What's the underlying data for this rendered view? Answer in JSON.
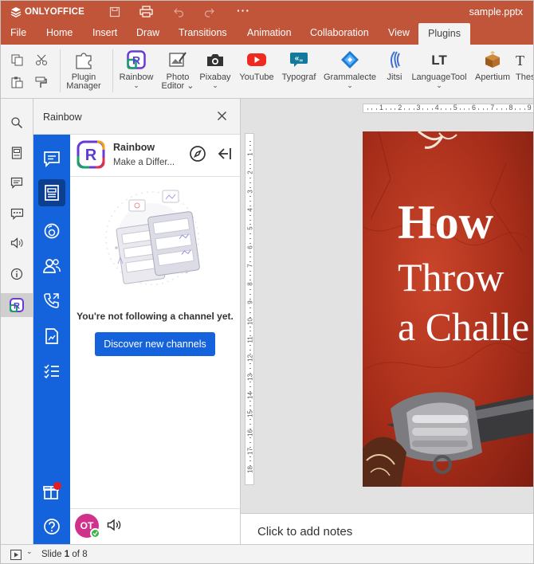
{
  "app": {
    "brand": "ONLYOFFICE",
    "file_name": "sample.pptx"
  },
  "menu": {
    "tabs": [
      "File",
      "Home",
      "Insert",
      "Draw",
      "Transitions",
      "Animation",
      "Collaboration",
      "View",
      "Plugins"
    ],
    "active": "Plugins"
  },
  "toolbar": {
    "plugin_manager": [
      "Plugin",
      "Manager"
    ],
    "plugins": [
      "Rainbow",
      "Photo Editor",
      "Pixabay",
      "YouTube",
      "Typograf",
      "Grammalecte",
      "Jitsi",
      "LanguageTool",
      "Apertium",
      "Thes"
    ],
    "photo_editor_lines": [
      "Photo",
      "Editor"
    ]
  },
  "panel": {
    "title": "Rainbow"
  },
  "rainbow": {
    "name": "Rainbow",
    "tagline": "Make a Differ...",
    "empty_text": "You're not following a channel yet.",
    "discover_button": "Discover new channels",
    "avatar_initials": "OT"
  },
  "ruler": {
    "horizontal": [
      "1",
      "2",
      "3",
      "4",
      "5",
      "6",
      "7",
      "8",
      "9"
    ],
    "vertical": [
      "1",
      "2",
      "3",
      "4",
      "5",
      "6",
      "7",
      "8",
      "9",
      "10",
      "11",
      "12",
      "13",
      "14",
      "15",
      "16",
      "17",
      "18"
    ]
  },
  "slide": {
    "line1": "How",
    "line2": "Throw",
    "line3": "a Challe"
  },
  "notes": {
    "placeholder": "Click to add notes"
  },
  "status": {
    "slide_label": "Slide",
    "current": "1",
    "of": "of",
    "total": "8"
  },
  "colors": {
    "brand_bar": "#c0553a",
    "rainbow_blue": "#1463dd",
    "slide_bg": "#b83a22"
  }
}
